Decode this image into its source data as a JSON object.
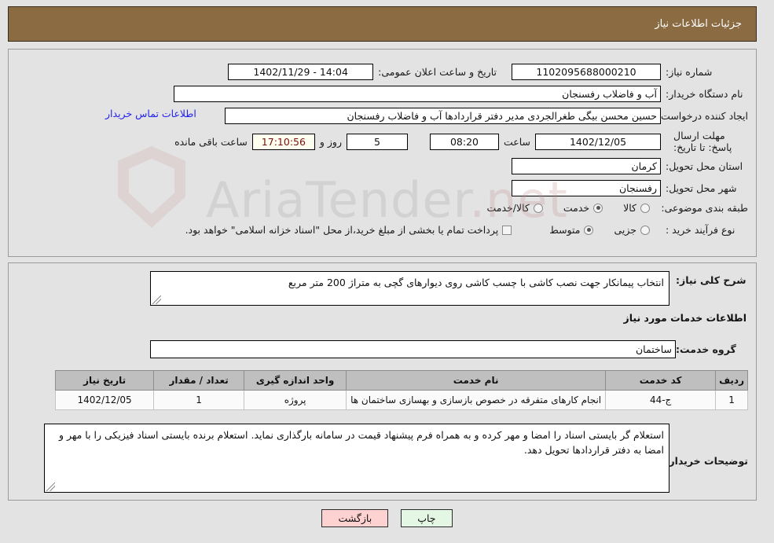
{
  "header": {
    "title": "جزئیات اطلاعات نیاز"
  },
  "colors": {
    "header_bar": "#8b6b42",
    "page_background": "#e3e3e3",
    "link": "#2222ee",
    "countdown_background": "#fffff0",
    "countdown_text": "#7a1010",
    "table_header": "#bfbfbf",
    "back_button": "#ffd2d2",
    "print_button": "#e4f6e4"
  },
  "top_panel": {
    "need_number": {
      "label": "شماره نیاز:",
      "value": "1102095688000210"
    },
    "public_announcement": {
      "label": "تاریخ و ساعت اعلان عمومی:",
      "value": "14:04 - 1402/11/29"
    },
    "buyer_org": {
      "label": "نام دستگاه خریدار:",
      "value": "آب و فاضلاب رفسنجان"
    },
    "request_creator": {
      "label": "ایجاد کننده درخواست:",
      "value": "حسین محسن بیگی طغرالجردی مدیر دفتر قراردادها آب و فاضلاب رفسنجان"
    },
    "buyer_contact_link": "اطلاعات تماس خریدار",
    "response_deadline": {
      "label": "مهلت ارسال پاسخ: تا تاریخ:",
      "date": "1402/12/05",
      "time_label": "ساعت",
      "time": "08:20",
      "days": "5",
      "days_suffix_label": "روز و",
      "countdown": "17:10:56",
      "countdown_suffix_label": "ساعت باقی مانده"
    },
    "delivery_province": {
      "label": "استان محل تحویل:",
      "value": "کرمان"
    },
    "delivery_city": {
      "label": "شهر محل تحویل:",
      "value": "رفسنجان"
    },
    "subject_category": {
      "label": "طبقه بندی موضوعی:",
      "options": [
        {
          "label": "کالا",
          "selected": false
        },
        {
          "label": "خدمت",
          "selected": true
        },
        {
          "label": "کالا/خدمت",
          "selected": false
        }
      ]
    },
    "purchase_process": {
      "label": "نوع فرآیند خرید :",
      "options": [
        {
          "label": "جزیی",
          "selected": false
        },
        {
          "label": "متوسط",
          "selected": true
        }
      ],
      "checkbox": {
        "label": "پرداخت تمام یا بخشی از مبلغ خرید،از محل \"اسناد خزانه اسلامی\" خواهد بود.",
        "checked": false
      }
    }
  },
  "bottom_panel": {
    "general_description": {
      "label": "شرح کلی نیاز:",
      "value": "انتخاب پیمانکار جهت نصب کاشی با چسب کاشی روی دیوارهای گچی به متراژ 200 متر مربع"
    },
    "services_section_title": "اطلاعات خدمات مورد نیاز",
    "service_group": {
      "label": "گروه خدمت:",
      "value": "ساختمان"
    },
    "table": {
      "headers": [
        "ردیف",
        "کد خدمت",
        "نام خدمت",
        "واحد اندازه گیری",
        "تعداد / مقدار",
        "تاریخ نیاز"
      ],
      "rows": [
        {
          "index": "1",
          "service_code": "ج-44",
          "service_name": "انجام کارهای متفرقه در خصوص بازسازی و بهسازی ساختمان ها",
          "unit": "پروژه",
          "quantity": "1",
          "need_date": "1402/12/05"
        }
      ]
    },
    "buyer_notes": {
      "label": "توضیحات خریدار:",
      "value": "استعلام گر بایستی اسناد را امضا و مهر کرده و به همراه فرم پیشنهاد قیمت در سامانه بارگذاری نماید. استعلام برنده بایستی اسناد فیزیکی را با مهر و امضا به دفتر قراردادها تحویل دهد."
    }
  },
  "footer": {
    "print_label": "چاپ",
    "back_label": "بازگشت"
  },
  "watermark": {
    "text_left": "AriaTender",
    "text_right": ".net"
  }
}
